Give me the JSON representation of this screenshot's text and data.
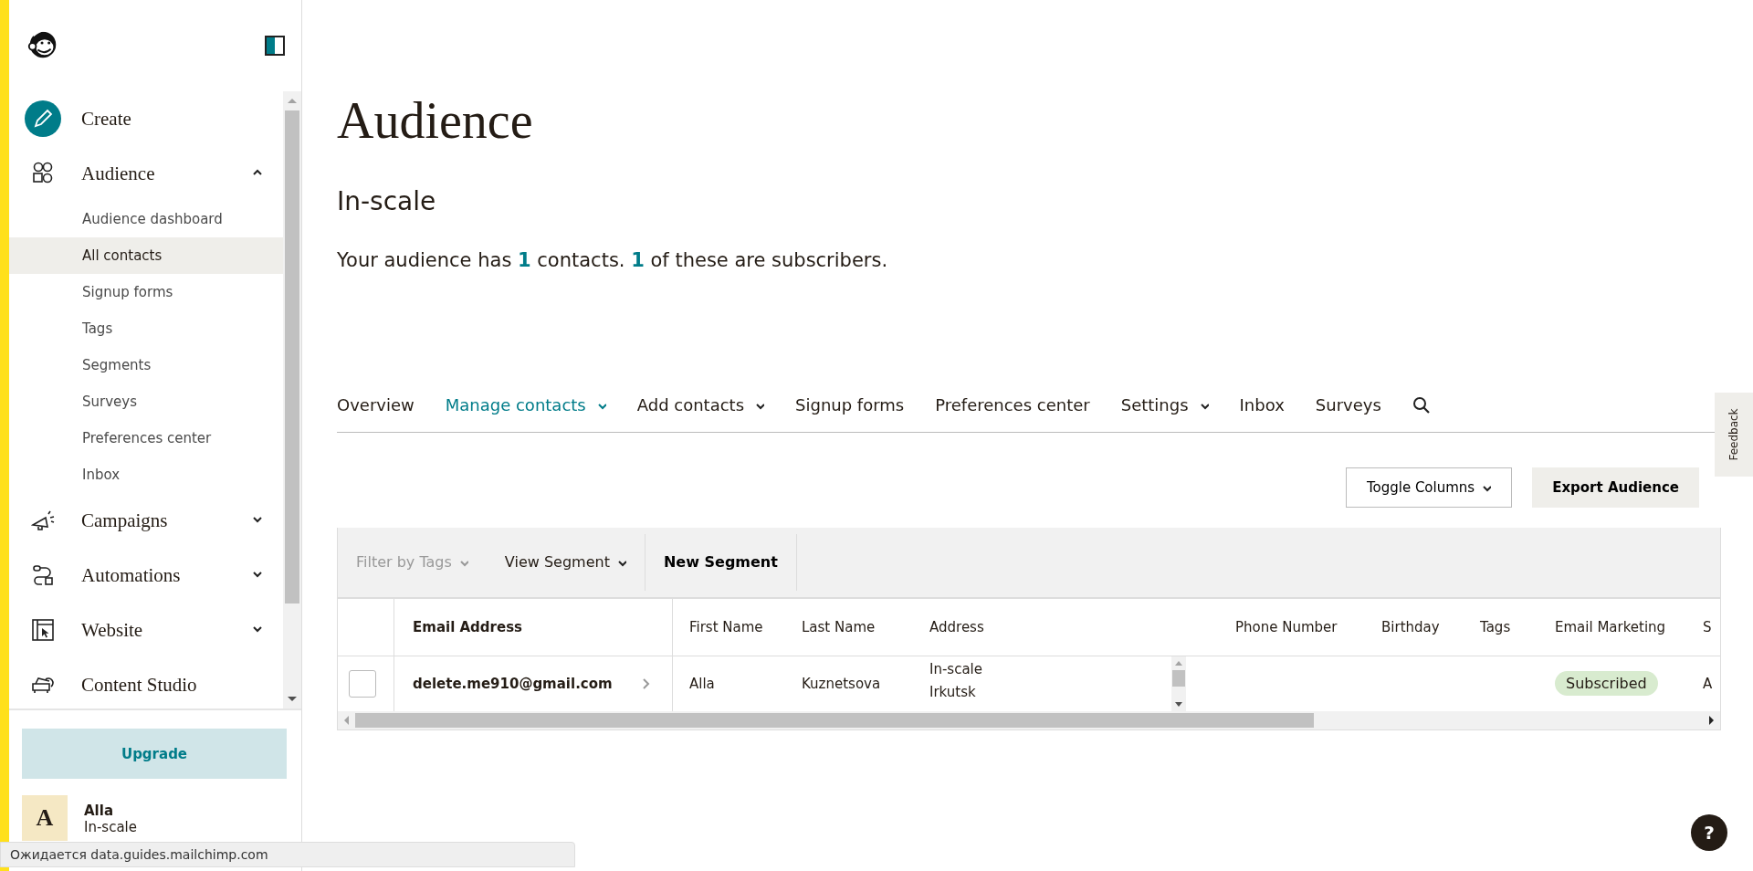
{
  "sidebar": {
    "nav": [
      {
        "label": "Create",
        "kind": "create"
      },
      {
        "label": "Audience",
        "kind": "audience",
        "expanded": true,
        "children": [
          {
            "label": "Audience dashboard",
            "selected": false
          },
          {
            "label": "All contacts",
            "selected": true
          },
          {
            "label": "Signup forms",
            "selected": false
          },
          {
            "label": "Tags",
            "selected": false
          },
          {
            "label": "Segments",
            "selected": false
          },
          {
            "label": "Surveys",
            "selected": false
          },
          {
            "label": "Preferences center",
            "selected": false
          },
          {
            "label": "Inbox",
            "selected": false
          }
        ]
      },
      {
        "label": "Campaigns",
        "kind": "campaigns",
        "expanded": false
      },
      {
        "label": "Automations",
        "kind": "automations",
        "expanded": false
      },
      {
        "label": "Website",
        "kind": "website",
        "expanded": false
      },
      {
        "label": "Content Studio",
        "kind": "content"
      }
    ],
    "upgrade": "Upgrade",
    "profile": {
      "initial": "A",
      "name": "Alla",
      "org": "In-scale"
    }
  },
  "page": {
    "title": "Audience",
    "subtitle": "In-scale",
    "summary": "Your audience has **1** contacts. **1** of these are subscribers."
  },
  "tabs": [
    {
      "label": "Overview",
      "selected": false,
      "dropdown": false
    },
    {
      "label": "Manage contacts",
      "selected": true,
      "dropdown": true
    },
    {
      "label": "Add contacts",
      "selected": false,
      "dropdown": true
    },
    {
      "label": "Signup forms",
      "selected": false,
      "dropdown": false
    },
    {
      "label": "Preferences center",
      "selected": false,
      "dropdown": false
    },
    {
      "label": "Settings",
      "selected": false,
      "dropdown": true
    },
    {
      "label": "Inbox",
      "selected": false,
      "dropdown": false
    },
    {
      "label": "Surveys",
      "selected": false,
      "dropdown": false
    }
  ],
  "actions": {
    "toggle_columns": "Toggle Columns",
    "export": "Export Audience"
  },
  "toolbar": {
    "filter": {
      "label": "Filter by Tags",
      "disabled": true
    },
    "view_segment": "View Segment",
    "new_segment": "New Segment"
  },
  "table": {
    "columns": [
      "Email Address",
      "First Name",
      "Last Name",
      "Address",
      "Phone Number",
      "Birthday",
      "Tags",
      "Email Marketing",
      "S"
    ],
    "rows": [
      {
        "checked": false,
        "email": "delete.me910@gmail.com",
        "first_name": "Alla",
        "last_name": "Kuznetsova",
        "address": [
          "In-scale",
          "Irkutsk"
        ],
        "email_marketing": "Subscribed",
        "column_9": "A"
      }
    ]
  },
  "feedback": "Feedback",
  "help": "?",
  "status_bar": "Ожидается data.guides.mailchimp.com"
}
